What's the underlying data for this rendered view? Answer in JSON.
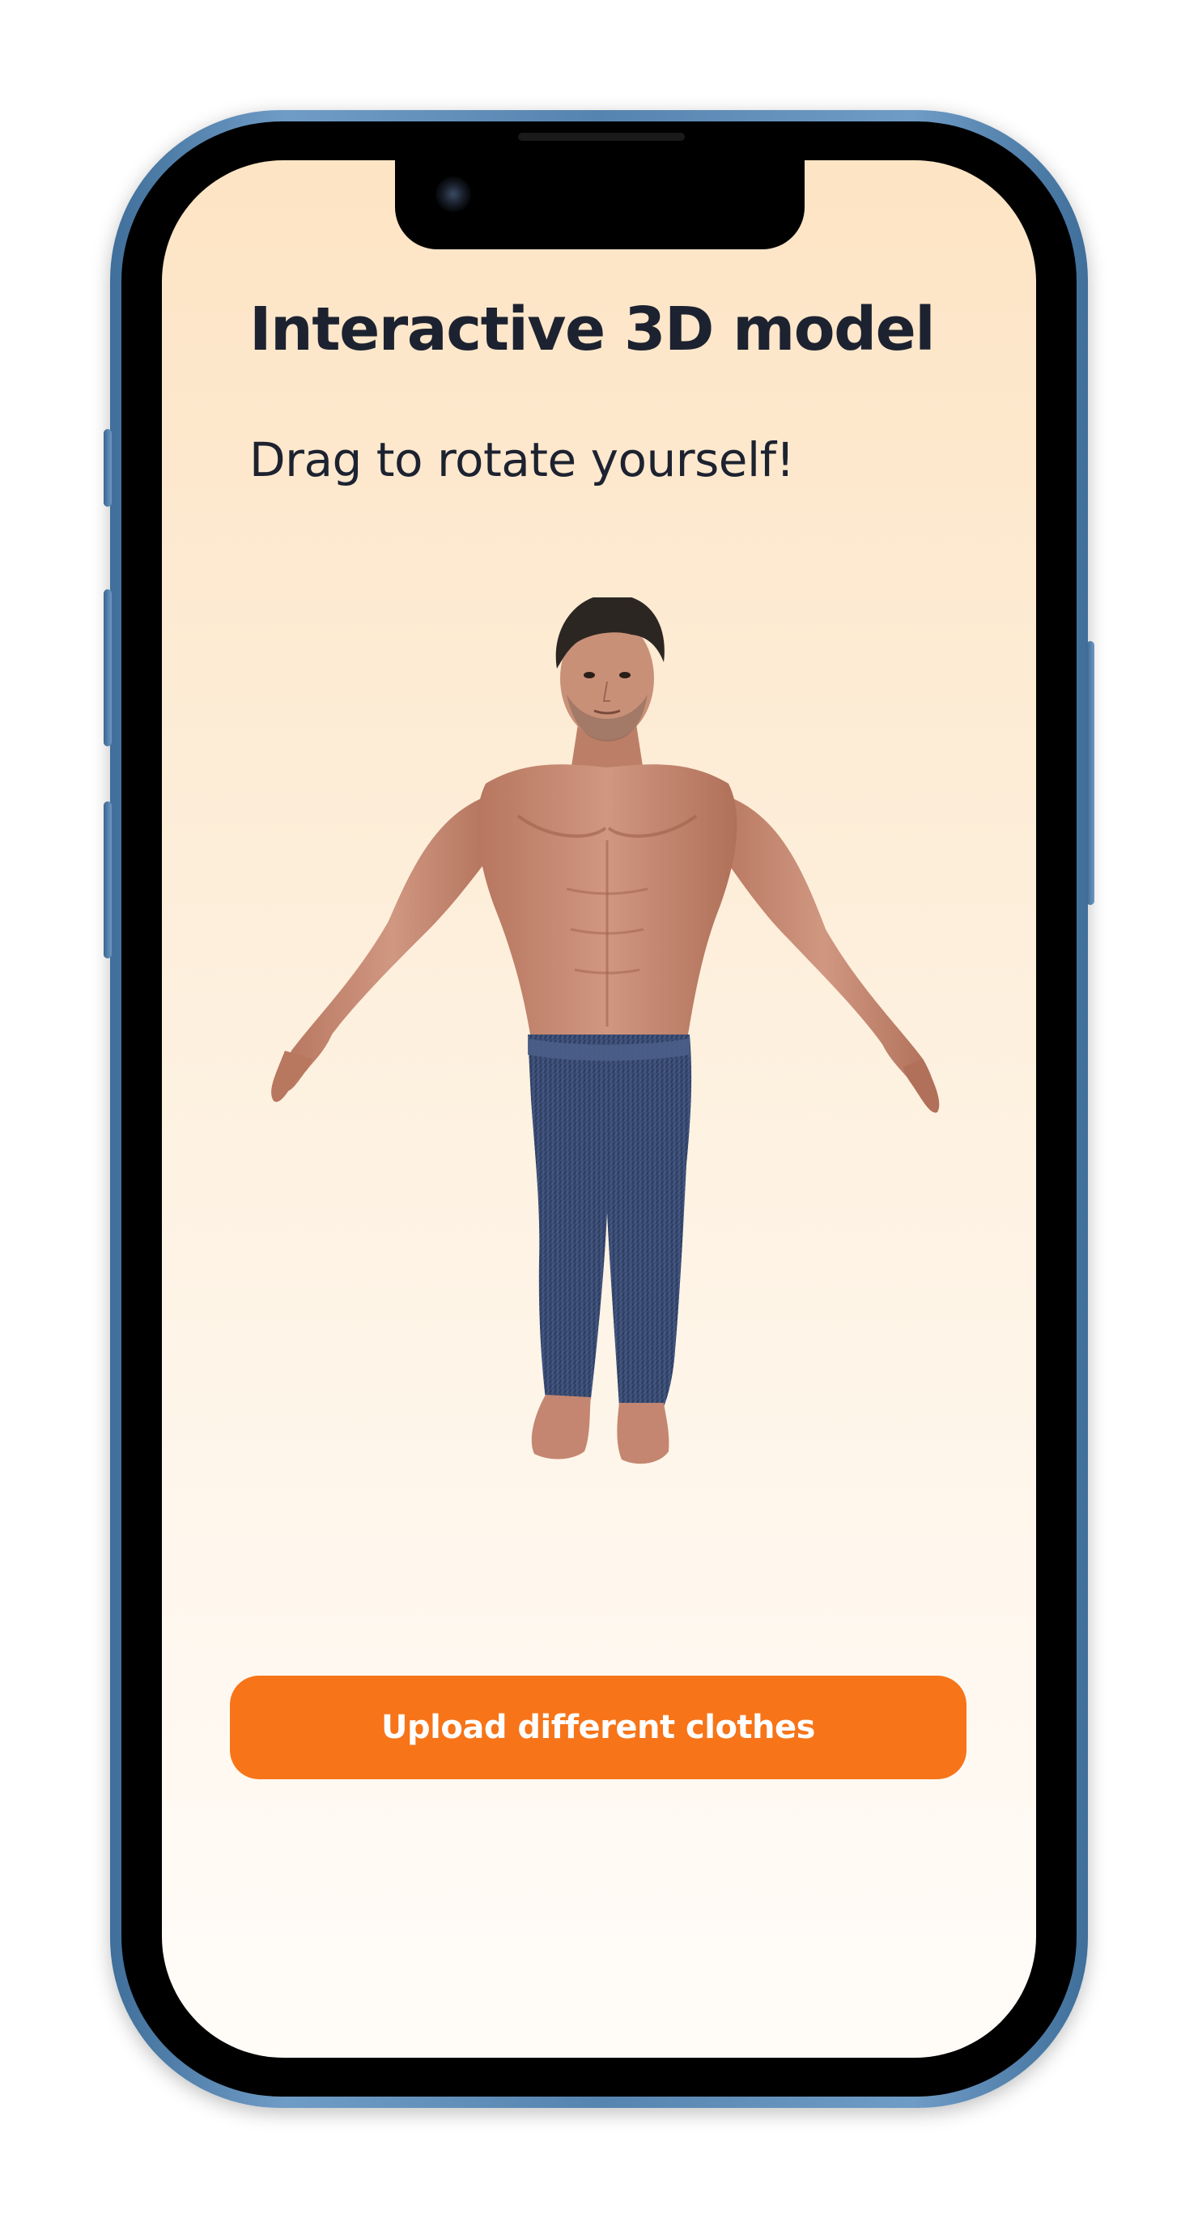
{
  "screen": {
    "title": "Interactive 3D model",
    "subtitle": "Drag to rotate yourself!",
    "upload_button_label": "Upload different clothes"
  },
  "model": {
    "icon": "avatar-3d-model",
    "skin_color": "#c98a73",
    "hair_color": "#2b2622",
    "pants_color": "#34466b"
  },
  "colors": {
    "accent": "#f77419",
    "title_text": "#1d2230",
    "background_top": "#fde4c4",
    "background_bottom": "#fffcf8",
    "frame": "#5684b0"
  }
}
